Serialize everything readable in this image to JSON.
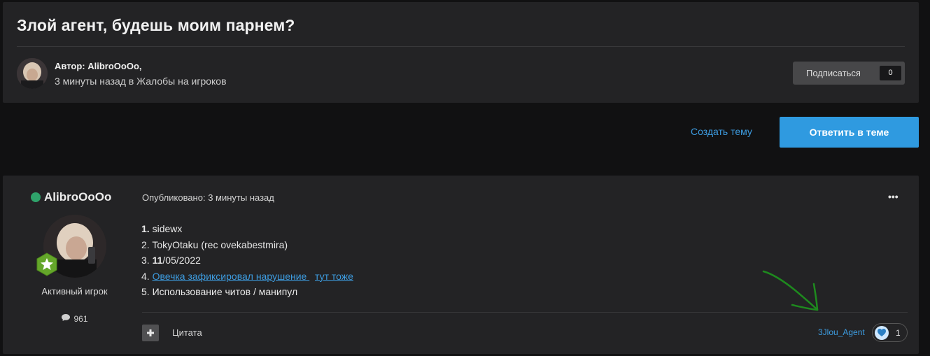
{
  "topic": {
    "title": "Злой агент, будешь моим парнем?",
    "author_label": "Автор: AlibroOoOo,",
    "meta": "3 минуты назад в Жалобы на игроков",
    "follow_label": "Подписаться",
    "follow_count": "0"
  },
  "actions": {
    "create_topic": "Создать тему",
    "reply": "Ответить в теме"
  },
  "post": {
    "author": "AlibroOoOo",
    "rank": "Активный игрок",
    "post_count": "961",
    "published": "Опубликовано: 3 минуты назад",
    "menu_icon": "•••",
    "lines": {
      "l1_num": "1.",
      "l1_text": " sidewx",
      "l2": "2. TokyOtaku (rec ovekabestmira)",
      "l3_num": "3.",
      "l3_bold": " 11",
      "l3_rest": "/05/2022",
      "l4_num": "4. ",
      "l4_link1": "Овечка зафиксировал нарушение ",
      "l4_link2": "тут тоже",
      "l5": "5. Использование читов / манипул"
    },
    "quote_label": "Цитата",
    "reaction_user": "3Jlou_Agent",
    "reaction_count": "1"
  },
  "colors": {
    "accent": "#2f9ae0",
    "link": "#3d9ce0",
    "online": "#2fa36b",
    "annotation_arrow": "#1e8a1e"
  },
  "icons": [
    "online-dot-icon",
    "star-badge-icon",
    "speech-bubble-icon",
    "plus-icon",
    "heart-icon",
    "ellipsis-icon"
  ]
}
